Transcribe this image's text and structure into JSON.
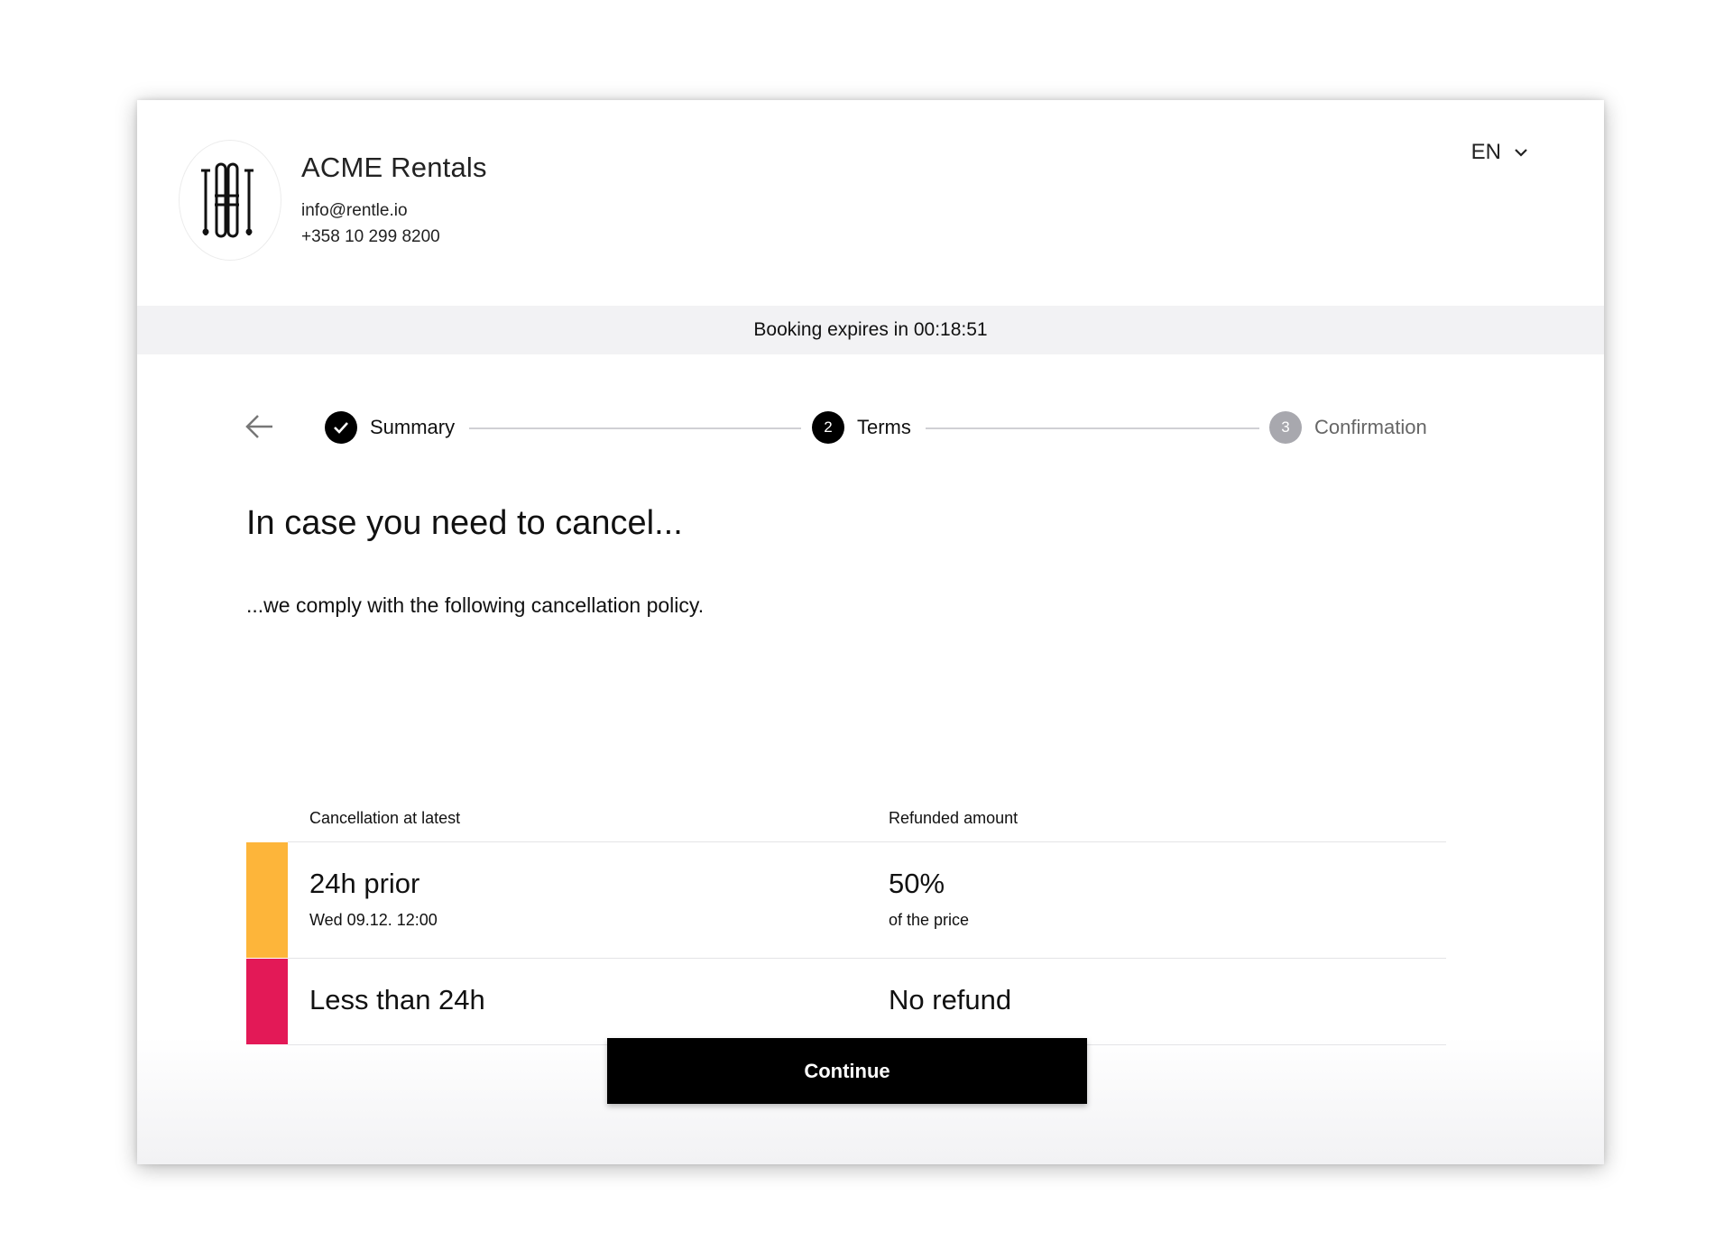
{
  "header": {
    "shop_name": "ACME Rentals",
    "email": "info@rentle.io",
    "phone": "+358 10 299 8200",
    "language": "EN",
    "logo_icon": "skis-icon"
  },
  "booking": {
    "expiry_text": "Booking expires in 00:18:51"
  },
  "stepper": {
    "steps": [
      {
        "label": "Summary",
        "status": "completed",
        "marker": ""
      },
      {
        "label": "Terms",
        "status": "current",
        "marker": "2"
      },
      {
        "label": "Confirmation",
        "status": "upcoming",
        "marker": "3"
      }
    ]
  },
  "content": {
    "heading": "In case you need to cancel...",
    "intro": "...we comply with the following cancellation policy."
  },
  "policy": {
    "headers": [
      "Cancellation at latest",
      "Refunded amount"
    ],
    "rows": [
      {
        "title": "24h prior",
        "subtitle": "Wed 09.12. 12:00",
        "refund": "50%",
        "refund_note": "of the price",
        "color": "#FDB53A"
      },
      {
        "title": "Less than 24h",
        "subtitle": "",
        "refund": "No refund",
        "refund_note": "",
        "color": "#E31957"
      }
    ]
  },
  "actions": {
    "continue_label": "Continue"
  }
}
